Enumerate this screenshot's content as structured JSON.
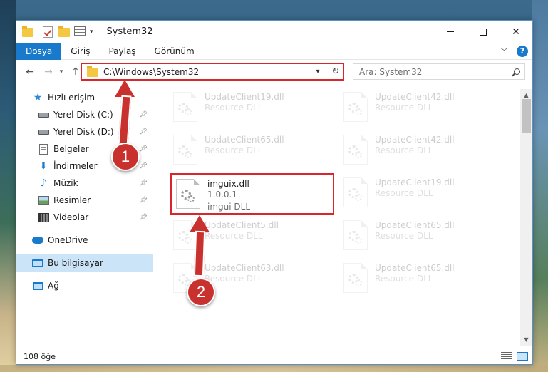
{
  "window": {
    "title": "System32"
  },
  "ribbon": {
    "tabs": [
      {
        "label": "Dosya",
        "active": true
      },
      {
        "label": "Giriş",
        "active": false
      },
      {
        "label": "Paylaş",
        "active": false
      },
      {
        "label": "Görünüm",
        "active": false
      }
    ],
    "help_icon_label": "?"
  },
  "address": {
    "path": "C:\\Windows\\System32",
    "search_placeholder": "Ara: System32"
  },
  "nav": {
    "items": [
      {
        "label": "Hızlı erişim",
        "icon": "star-icon",
        "pinned": false
      },
      {
        "label": "Yerel Disk (C:)",
        "icon": "drive-icon",
        "pinned": true
      },
      {
        "label": "Yerel Disk (D:)",
        "icon": "drive-icon",
        "pinned": true
      },
      {
        "label": "Belgeler",
        "icon": "document-icon",
        "pinned": true
      },
      {
        "label": "İndirmeler",
        "icon": "download-icon",
        "pinned": true
      },
      {
        "label": "Müzik",
        "icon": "music-icon",
        "pinned": true
      },
      {
        "label": "Resimler",
        "icon": "pictures-icon",
        "pinned": true
      },
      {
        "label": "Videolar",
        "icon": "videos-icon",
        "pinned": true
      },
      {
        "label": "OneDrive",
        "icon": "cloud-icon",
        "pinned": false
      },
      {
        "label": "Bu bilgisayar",
        "icon": "computer-icon",
        "pinned": false,
        "selected": true
      },
      {
        "label": "Ağ",
        "icon": "network-icon",
        "pinned": false
      }
    ]
  },
  "files": [
    {
      "name": "UpdateClient19.dll",
      "detail": "Resource DLL",
      "faded": true
    },
    {
      "name": "UpdateClient42.dll",
      "detail": "Resource DLL",
      "faded": true
    },
    {
      "name": "UpdateClient65.dll",
      "detail": "Resource DLL",
      "faded": true
    },
    {
      "name": "UpdateClient42.dll",
      "detail": "Resource DLL",
      "faded": true
    },
    {
      "name": "imguix.dll",
      "version": "1.0.0.1",
      "detail": "imgui DLL",
      "faded": false,
      "highlighted": true
    },
    {
      "name": "UpdateClient19.dll",
      "detail": "Resource DLL",
      "faded": true
    },
    {
      "name": "UpdateClient5.dll",
      "detail": "Resource DLL",
      "faded": true
    },
    {
      "name": "UpdateClient65.dll",
      "detail": "Resource DLL",
      "faded": true
    },
    {
      "name": "UpdateClient63.dll",
      "detail": "Resource DLL",
      "faded": true
    },
    {
      "name": "UpdateClient65.dll",
      "detail": "Resource DLL",
      "faded": true
    }
  ],
  "status": {
    "item_count": "108 öğe"
  },
  "annotations": {
    "step1": "1",
    "step2": "2",
    "accent_color": "#c9312e"
  }
}
